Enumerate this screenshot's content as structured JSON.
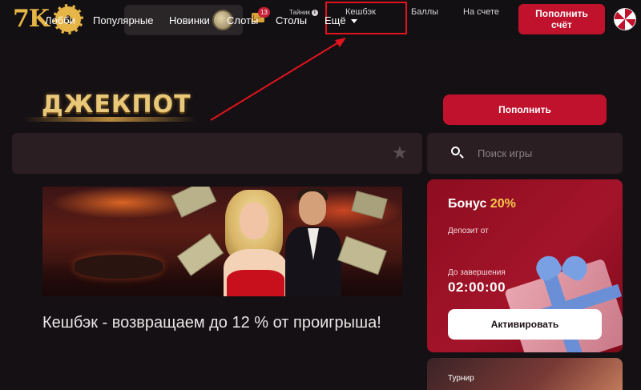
{
  "header": {
    "logo_text": "7K",
    "mail_badge": "13",
    "nav": {
      "secret": "Тайник",
      "cashback": "Кешбэк",
      "points": "Баллы",
      "on_account": "На счете"
    },
    "topup_label": "Пополнить счёт"
  },
  "hero": {
    "jackpot": "ДЖЕКПОТ",
    "topup_label": "Пополнить"
  },
  "categories": {
    "items": [
      "Лобби",
      "Популярные",
      "Новинки",
      "Слоты",
      "Столы",
      "Ещё"
    ]
  },
  "search": {
    "placeholder": "Поиск игры"
  },
  "banner": {
    "caption": "Кешбэк - возвращаем до 12 % от проигрыша!"
  },
  "bonus": {
    "title": "Бонус",
    "percent": "20%",
    "deposit_label": "Депозит от",
    "until_label": "До завершения",
    "timer": "02:00:00",
    "activate_label": "Активировать"
  },
  "tournament": {
    "label": "Турнир"
  },
  "colors": {
    "accent_red": "#c0122c",
    "gold": "#e6b547",
    "highlight_box": "#e0141f",
    "background": "#151013"
  },
  "icons": [
    "club-chip-icon",
    "coin-icon",
    "mail-icon",
    "info-icon",
    "avatar-icon",
    "star-icon",
    "search-icon",
    "chevron-down-icon",
    "gift-icon"
  ]
}
